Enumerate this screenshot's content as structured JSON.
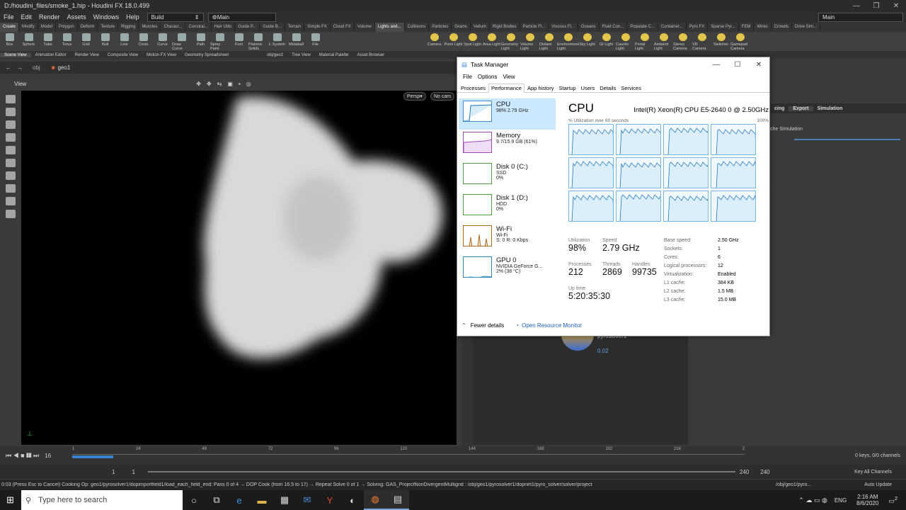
{
  "window": {
    "title": "D:/houdini_files/smoke_1.hip - Houdini FX 18.0.499"
  },
  "menu": {
    "items": [
      "File",
      "Edit",
      "Render",
      "Assets",
      "Windows",
      "Help"
    ],
    "desktop": "Build",
    "desktop2": "Main",
    "right": "Main"
  },
  "shelf_tabs": [
    "Create",
    "Modify",
    "Model",
    "Polygon",
    "Deform",
    "Texture",
    "Rigging",
    "Muscles",
    "Charact...",
    "Constrai...",
    "Hair Utils",
    "Guide P...",
    "Guide B...",
    "Terrain",
    "Simple FX",
    "Cloud FX",
    "Volume",
    "Lights and...",
    "Collisions",
    "Particles",
    "Grains",
    "Vellum",
    "Rigid Bodies",
    "Particle Fl...",
    "Viscous Fl...",
    "Oceans",
    "Fluid Con...",
    "Populate C...",
    "Container...",
    "Pyro FX",
    "Sparse Pyr...",
    "FEM",
    "Wires",
    "Crowds",
    "Drive Sim..."
  ],
  "shelf_tools": [
    "Box",
    "Sphere",
    "Tube",
    "Torus",
    "Grid",
    "Null",
    "Line",
    "Circle",
    "Curve",
    "Draw Curve",
    "Path",
    "Spray Paint",
    "Font",
    "Platonic Solids",
    "L-System",
    "Metaball",
    "File"
  ],
  "light_tools": [
    "Camera",
    "Point Light",
    "Spot Light",
    "Area Light",
    "Geometry Light",
    "Volume Light",
    "Distant Light",
    "Environment Light",
    "Sky Light",
    "GI Light",
    "Caustic Light",
    "Portal Light",
    "Ambient Light",
    "Stereo Camera",
    "VR Camera",
    "Switcher",
    "Gamepad Camera"
  ],
  "pane_tabs": [
    "Scene View",
    "Animation Editor",
    "Render View",
    "Composite View",
    "Motion FX View",
    "Geometry Spreadsheet"
  ],
  "pane_tabs2": [
    "obj/geo2",
    "Tree View",
    "Material Palette",
    "Asset Browser"
  ],
  "path": {
    "obj": "obj",
    "geo": "geo1"
  },
  "viewer": {
    "label": "View",
    "persp": "Persp",
    "cam": "No cam"
  },
  "network": {
    "node_name": "pyrosolver1",
    "node_value": "0.02"
  },
  "right_panel": {
    "tabs": [
      "cing",
      "Export",
      "Simulation"
    ],
    "label": "che Simulation"
  },
  "timeline": {
    "frame": "16",
    "ticks": [
      "1",
      "24",
      "48",
      "72",
      "96",
      "120",
      "144",
      "168",
      "192",
      "216",
      "2"
    ],
    "start": "1",
    "start2": "1",
    "end": "240",
    "end2": "240",
    "keys": "0 keys, 0/0 channels",
    "key_all": "Key All Channels"
  },
  "status": {
    "text": "0:03 (Press Esc to Cancel) Cooking Op: geo1/pyrosolver1/dopimportfield1/load_each_field_end: Pass 0 of 4 → DOP Cook (from 16.5 to 17) → Repeat Solve 0 of 1 → Solving: GAS_ProjectNonDivergentMultigrid : /obj/geo1/pyrosolver1/dopnet1/pyro_solver/solver/project",
    "path": "/obj/geo1/pyro...",
    "update": "Auto Update"
  },
  "taskbar": {
    "search": "Type here to search",
    "lang": "ENG",
    "time": "2:16 AM",
    "date": "8/6/2020",
    "notif": "2"
  },
  "taskmgr": {
    "title": "Task Manager",
    "menu": [
      "File",
      "Options",
      "View"
    ],
    "tabs": [
      "Processes",
      "Performance",
      "App history",
      "Startup",
      "Users",
      "Details",
      "Services"
    ],
    "side": [
      {
        "name": "CPU",
        "sub1": "98% 2.79 GHz",
        "sub2": ""
      },
      {
        "name": "Memory",
        "sub1": "9.7/15.9 GB (61%)",
        "sub2": ""
      },
      {
        "name": "Disk 0 (C:)",
        "sub1": "SSD",
        "sub2": "0%"
      },
      {
        "name": "Disk 1 (D:)",
        "sub1": "HDD",
        "sub2": "0%"
      },
      {
        "name": "Wi-Fi",
        "sub1": "Wi-Fi",
        "sub2": "S: 0 R: 0 Kbps"
      },
      {
        "name": "GPU 0",
        "sub1": "NVIDIA GeForce G...",
        "sub2": "2% (38 °C)"
      }
    ],
    "cpu_title": "CPU",
    "cpu_name": "Intel(R) Xeon(R) CPU E5-2640 0 @ 2.50GHz",
    "axis_left": "% Utilization over 60 seconds",
    "axis_right": "100%",
    "utilization_label": "Utilization",
    "utilization": "98%",
    "speed_label": "Speed",
    "speed": "2.79 GHz",
    "processes_label": "Processes",
    "processes": "212",
    "threads_label": "Threads",
    "threads": "2869",
    "handles_label": "Handles",
    "handles": "99735",
    "uptime_label": "Up time",
    "uptime": "5:20:35:30",
    "details": [
      {
        "k": "Base speed:",
        "v": "2.50 GHz"
      },
      {
        "k": "Sockets:",
        "v": "1"
      },
      {
        "k": "Cores:",
        "v": "6"
      },
      {
        "k": "Logical processors:",
        "v": "12"
      },
      {
        "k": "Virtualization:",
        "v": "Enabled"
      },
      {
        "k": "L1 cache:",
        "v": "384 KB"
      },
      {
        "k": "L2 cache:",
        "v": "1.5 MB"
      },
      {
        "k": "L3 cache:",
        "v": "15.0 MB"
      }
    ],
    "fewer": "Fewer details",
    "monitor": "Open Resource Monitor"
  }
}
